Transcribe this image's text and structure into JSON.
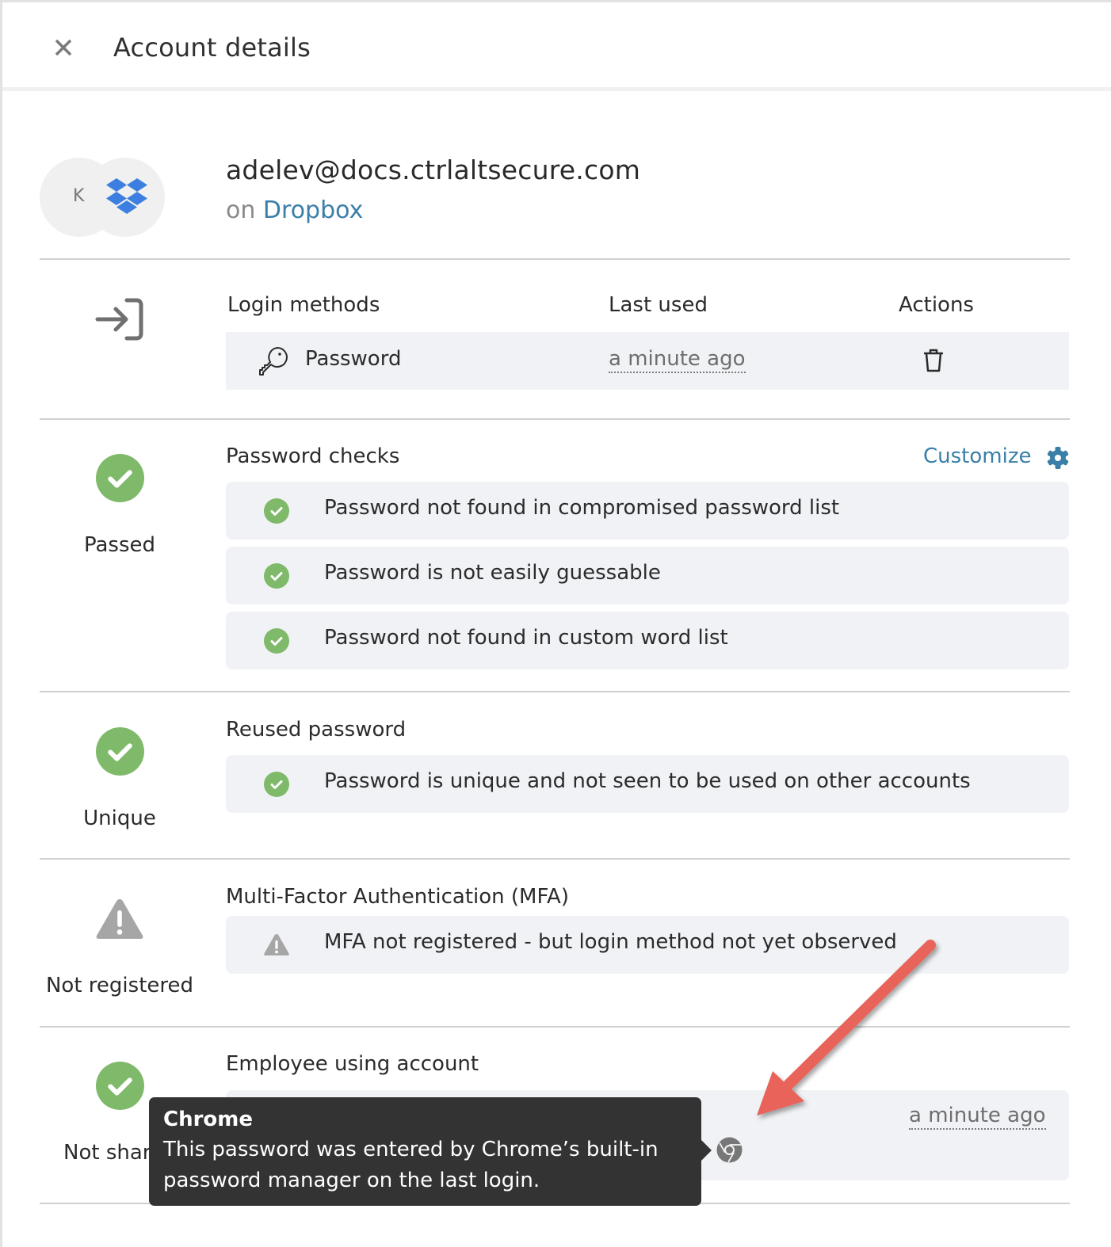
{
  "header": {
    "title": "Account details",
    "close_icon": "close-icon"
  },
  "account": {
    "avatar_initial": "K",
    "app_icon": "dropbox-logo-icon",
    "email": "adelev@docs.ctrlaltsecure.com",
    "on_prefix": "on",
    "app_name": "Dropbox"
  },
  "login_methods": {
    "icon": "sign-in-icon",
    "columns": [
      "Login methods",
      "Last used",
      "Actions"
    ],
    "rows": [
      {
        "method": "Password",
        "method_icon": "key-icon",
        "last_used": "a minute ago",
        "action_icon": "trash-icon"
      }
    ]
  },
  "password_checks": {
    "status": "Passed",
    "status_icon": "check-circle-icon",
    "title": "Password checks",
    "customize_label": "Customize",
    "customize_icon": "gear-icon",
    "items": [
      {
        "text": "Password not found in compromised password list",
        "icon": "check-circle-icon"
      },
      {
        "text": "Password is not easily guessable",
        "icon": "check-circle-icon"
      },
      {
        "text": "Password not found in custom word list",
        "icon": "check-circle-icon"
      }
    ]
  },
  "reused_password": {
    "status": "Unique",
    "status_icon": "check-circle-icon",
    "title": "Reused password",
    "items": [
      {
        "text": "Password is unique and not seen to be used on other accounts",
        "icon": "check-circle-icon"
      }
    ]
  },
  "mfa": {
    "status": "Not registered",
    "status_icon": "warning-icon",
    "title": "Multi-Factor Authentication (MFA)",
    "items": [
      {
        "text": "MFA not registered - but login method not yet observed",
        "icon": "warning-icon"
      }
    ]
  },
  "employee": {
    "status": "Not shared",
    "status_visible": "Not shar",
    "status_icon": "check-circle-icon",
    "title": "Employee using account",
    "last_used": "a minute ago",
    "browser_icon": "chrome-icon"
  },
  "tooltip": {
    "title": "Chrome",
    "body": "This password was entered by Chrome’s built-in password manager on the last login."
  },
  "colors": {
    "accent": "#3a7fa8",
    "success": "#7fba6a",
    "warning": "#a6a6a6",
    "row_bg": "#f1f2f5",
    "tooltip_bg": "#333333",
    "annotation_arrow": "#e8645a",
    "dropbox": "#3d7fe0"
  }
}
